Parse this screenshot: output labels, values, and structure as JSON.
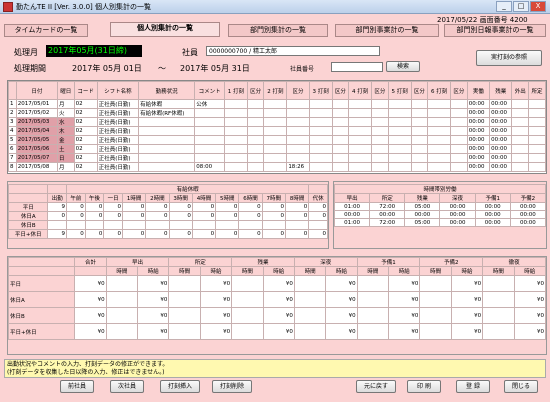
{
  "window": {
    "title": "勤たんTE II [Ver. 3.0.0] 個人別集計の一覧",
    "min": "_",
    "max": "□",
    "close": "X"
  },
  "header": {
    "date_info": "2017/05/22  画面番号 4200"
  },
  "tabs": [
    "タイムカードの一覧",
    "個人別集計の一覧",
    "部門別集計の一覧",
    "部門別事業計の一覧",
    "部門別日報事業計の一覧"
  ],
  "form": {
    "period_label": "処理月",
    "period_value": "2017年05月(31日締)",
    "range_label": "処理期間",
    "range_start": "2017年  05月  01日",
    "tilde": "〜",
    "range_end": "2017年  05月  31日",
    "employee_label": "社員",
    "employee_value": "0000000700 / 精工太郎",
    "empno_label": "社員番号",
    "search_button": "検索",
    "print_actual_button": "実打刻の参照"
  },
  "daily_headers": [
    "日付",
    "曜日",
    "コード",
    "シフト名称",
    "勤務状況",
    "コメント",
    "1 打刻",
    "区分",
    "2 打刻",
    "区分",
    "3 打刻",
    "区分",
    "4 打刻",
    "区分",
    "5 打刻",
    "区分",
    "6 打刻",
    "区分",
    "実働",
    "残業",
    "外出",
    "所定"
  ],
  "daily_rows": [
    [
      "1",
      "2017/05/01",
      "月",
      "02",
      "正社員(日勤)",
      "有給休暇",
      "公休",
      "",
      "00:00",
      "00:00"
    ],
    [
      "2",
      "2017/05/02",
      "火",
      "02",
      "正社員(日勤)",
      "有給休暇(RF休暇)",
      "",
      "",
      "00:00",
      "00:00"
    ],
    [
      "3",
      "2017/05/03",
      "水",
      "02",
      "正社員(日勤)",
      "",
      "",
      "",
      "00:00",
      "00:00"
    ],
    [
      "4",
      "2017/05/04",
      "木",
      "02",
      "正社員(日勤)",
      "",
      "",
      "",
      "00:00",
      "00:00"
    ],
    [
      "5",
      "2017/05/05",
      "金",
      "02",
      "正社員(日勤)",
      "",
      "",
      "",
      "00:00",
      "00:00"
    ],
    [
      "6",
      "2017/05/06",
      "土",
      "02",
      "正社員(日勤)",
      "",
      "",
      "",
      "00:00",
      "00:00"
    ],
    [
      "7",
      "2017/05/07",
      "日",
      "02",
      "正社員(日勤)",
      "",
      "",
      "",
      "00:00",
      "00:00"
    ],
    [
      "8",
      "2017/05/08",
      "月",
      "02",
      "正社員(日勤)",
      "",
      "08:00",
      "18:26",
      "00:00",
      "00:00"
    ]
  ],
  "summary": {
    "col_headers": [
      "出勤",
      "午前",
      "午後",
      "一日",
      "1時間",
      "2時間",
      "3時間",
      "4時間",
      "5時間",
      "6時間",
      "7時間",
      "8時間",
      "代休"
    ],
    "group_label": "有給休暇",
    "rows": [
      {
        "label": "平日",
        "vals": [
          "9",
          "0",
          "0",
          "0",
          "0",
          "0",
          "0",
          "0",
          "0",
          "0",
          "0",
          "0",
          "0"
        ]
      },
      {
        "label": "休日A",
        "vals": [
          "0",
          "0",
          "0",
          "0",
          "0",
          "0",
          "0",
          "0",
          "0",
          "0",
          "0",
          "0",
          "0"
        ]
      },
      {
        "label": "休日B",
        "vals": [
          "",
          "",
          "",
          "",
          "",
          "",
          "",
          "",
          "",
          "",
          "",
          "",
          ""
        ]
      },
      {
        "label": "平日+休日",
        "vals": [
          "9",
          "0",
          "0",
          "0",
          "0",
          "0",
          "0",
          "0",
          "0",
          "0",
          "0",
          "0",
          "0"
        ]
      }
    ]
  },
  "time_summary": {
    "group_label": "時間帯別労働",
    "cols": [
      "早出",
      "所定",
      "残業",
      "深夜",
      "予備1",
      "予備2"
    ],
    "rows": [
      [
        "01:00",
        "72:00",
        "05:00",
        "00:00",
        "00:00",
        "00:00"
      ],
      [
        "00:00",
        "00:00",
        "00:00",
        "00:00",
        "00:00",
        "00:00"
      ],
      [
        "01:00",
        "72:00",
        "05:00",
        "00:00",
        "00:00",
        "00:00"
      ]
    ]
  },
  "money": {
    "groups": [
      "合計",
      "早出",
      "所定",
      "残業",
      "深夜",
      "予備1",
      "予備2",
      "徹夜"
    ],
    "sub": [
      "時間",
      "時給"
    ],
    "rows": [
      "平日",
      "休日A",
      "休日B",
      "平日+休日"
    ],
    "value": "¥0"
  },
  "message": {
    "line1": "出勤状況やコメントの入力、打刻データの修正ができます。",
    "line2": "(打刻データを収集した日以降の入力、修正はできません。)"
  },
  "buttons": {
    "prev": "前社員",
    "next": "次社員",
    "insert": "打刻挿入",
    "delete": "打刻削除",
    "restore": "元に戻す",
    "print": "印 刷",
    "register": "登 録",
    "close": "閉じる"
  }
}
